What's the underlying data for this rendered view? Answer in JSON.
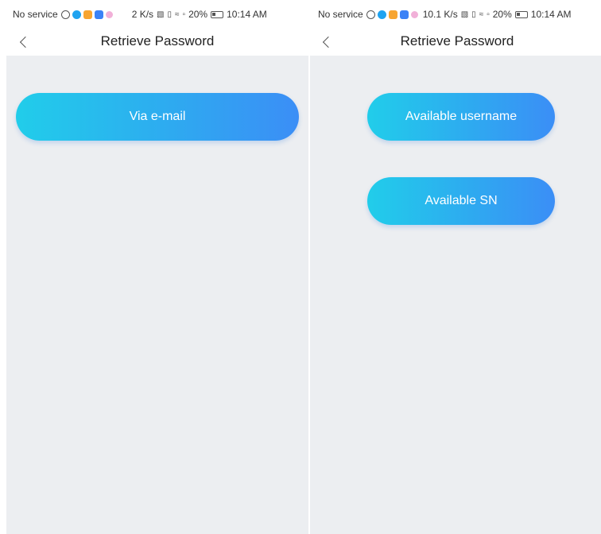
{
  "left": {
    "status": {
      "carrier": "No service",
      "speed": "2 K/s",
      "battery_pct": "20%",
      "time": "10:14 AM"
    },
    "nav": {
      "title": "Retrieve Password"
    },
    "buttons": {
      "email": "Via e-mail"
    }
  },
  "right": {
    "status": {
      "carrier": "No service",
      "speed": "10.1 K/s",
      "battery_pct": "20%",
      "time": "10:14 AM"
    },
    "nav": {
      "title": "Retrieve Password"
    },
    "buttons": {
      "username": "Available username",
      "sn": "Available SN"
    }
  },
  "colors": {
    "accent_start": "#21cdea",
    "accent_end": "#3b8ef6",
    "content_bg": "#eceef1"
  }
}
